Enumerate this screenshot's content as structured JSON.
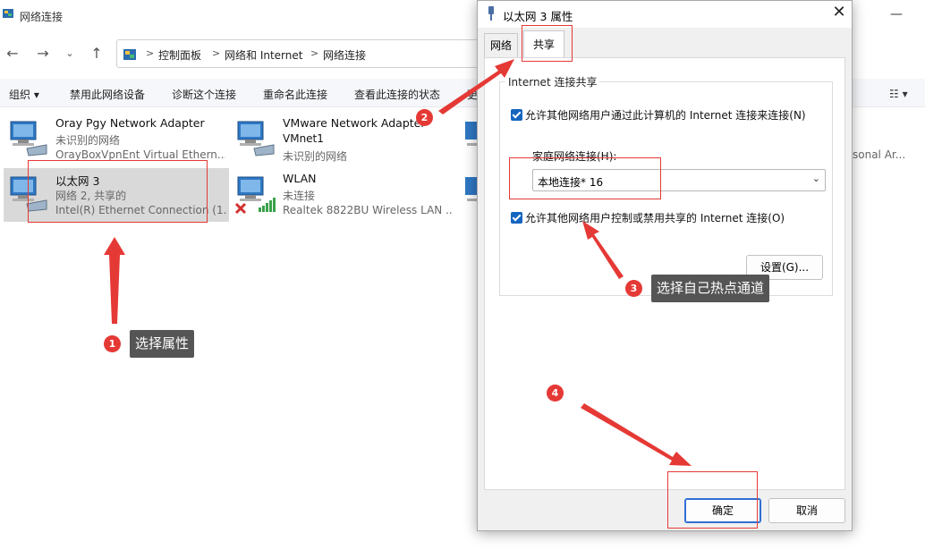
{
  "explorer": {
    "title": "网络连接",
    "breadcrumb": [
      "控制面板",
      "网络和 Internet",
      "网络连接"
    ],
    "toolbar": [
      "组织 ▾",
      "禁用此网络设备",
      "诊断这个连接",
      "重命名此连接",
      "查看此连接的状态",
      "更"
    ],
    "adapters": [
      {
        "name": "Oray Pgy Network Adapter",
        "status": "未识别的网络",
        "device": "OrayBoxVpnEnt Virtual Ethern..."
      },
      {
        "name": "VMware Network Adapter",
        "name2": "VMnet1",
        "status": "未识别的网络",
        "device": ""
      },
      {
        "name": "以太网 3",
        "status": "网络 2, 共享的",
        "device": "Intel(R) Ethernet Connection (1..."
      },
      {
        "name": "WLAN",
        "status": "未连接",
        "device": "Realtek 8822BU Wireless LAN ..."
      }
    ],
    "partial_text": "sonal Ar..."
  },
  "dialog": {
    "title": "以太网 3 属性",
    "tabs": [
      "网络",
      "共享"
    ],
    "group_title": "Internet 连接共享",
    "allow_connect": "允许其他网络用户通过此计算机的 Internet 连接来连接(N)",
    "home_label": "家庭网络连接(H):",
    "home_value": "本地连接* 16",
    "allow_control": "允许其他网络用户控制或禁用共享的 Internet 连接(O)",
    "settings_btn": "设置(G)...",
    "ok_btn": "确定",
    "cancel_btn": "取消"
  },
  "annotations": {
    "step1_num": "1",
    "step1_label": "选择属性",
    "step2_num": "2",
    "step3_num": "3",
    "step3_label": "选择自己热点通道",
    "step4_num": "4",
    "color": "#e53935"
  }
}
